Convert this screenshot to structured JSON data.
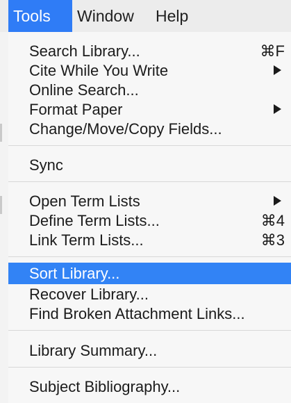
{
  "menubar": {
    "items": [
      {
        "label": "Tools",
        "active": true
      },
      {
        "label": "Window"
      },
      {
        "label": "Help"
      }
    ]
  },
  "menu": {
    "items": [
      {
        "label": "Search Library...",
        "shortcut": "⌘F"
      },
      {
        "label": "Cite While You Write",
        "submenu": true
      },
      {
        "label": "Online Search..."
      },
      {
        "label": "Format Paper",
        "submenu": true
      },
      {
        "label": "Change/Move/Copy Fields..."
      },
      {
        "label": "Sync"
      },
      {
        "label": "Open Term Lists",
        "submenu": true
      },
      {
        "label": "Define Term Lists...",
        "shortcut": "⌘4"
      },
      {
        "label": "Link Term Lists...",
        "shortcut": "⌘3"
      },
      {
        "label": "Sort Library...",
        "highlighted": true
      },
      {
        "label": "Recover Library..."
      },
      {
        "label": "Find Broken Attachment Links..."
      },
      {
        "label": "Library Summary..."
      },
      {
        "label": "Subject Bibliography..."
      }
    ]
  },
  "colors": {
    "highlight": "#3283f5",
    "menubar_active": "#2f7cf6",
    "menu_background": "#f7f7f7",
    "separator": "#d8d8d8"
  }
}
